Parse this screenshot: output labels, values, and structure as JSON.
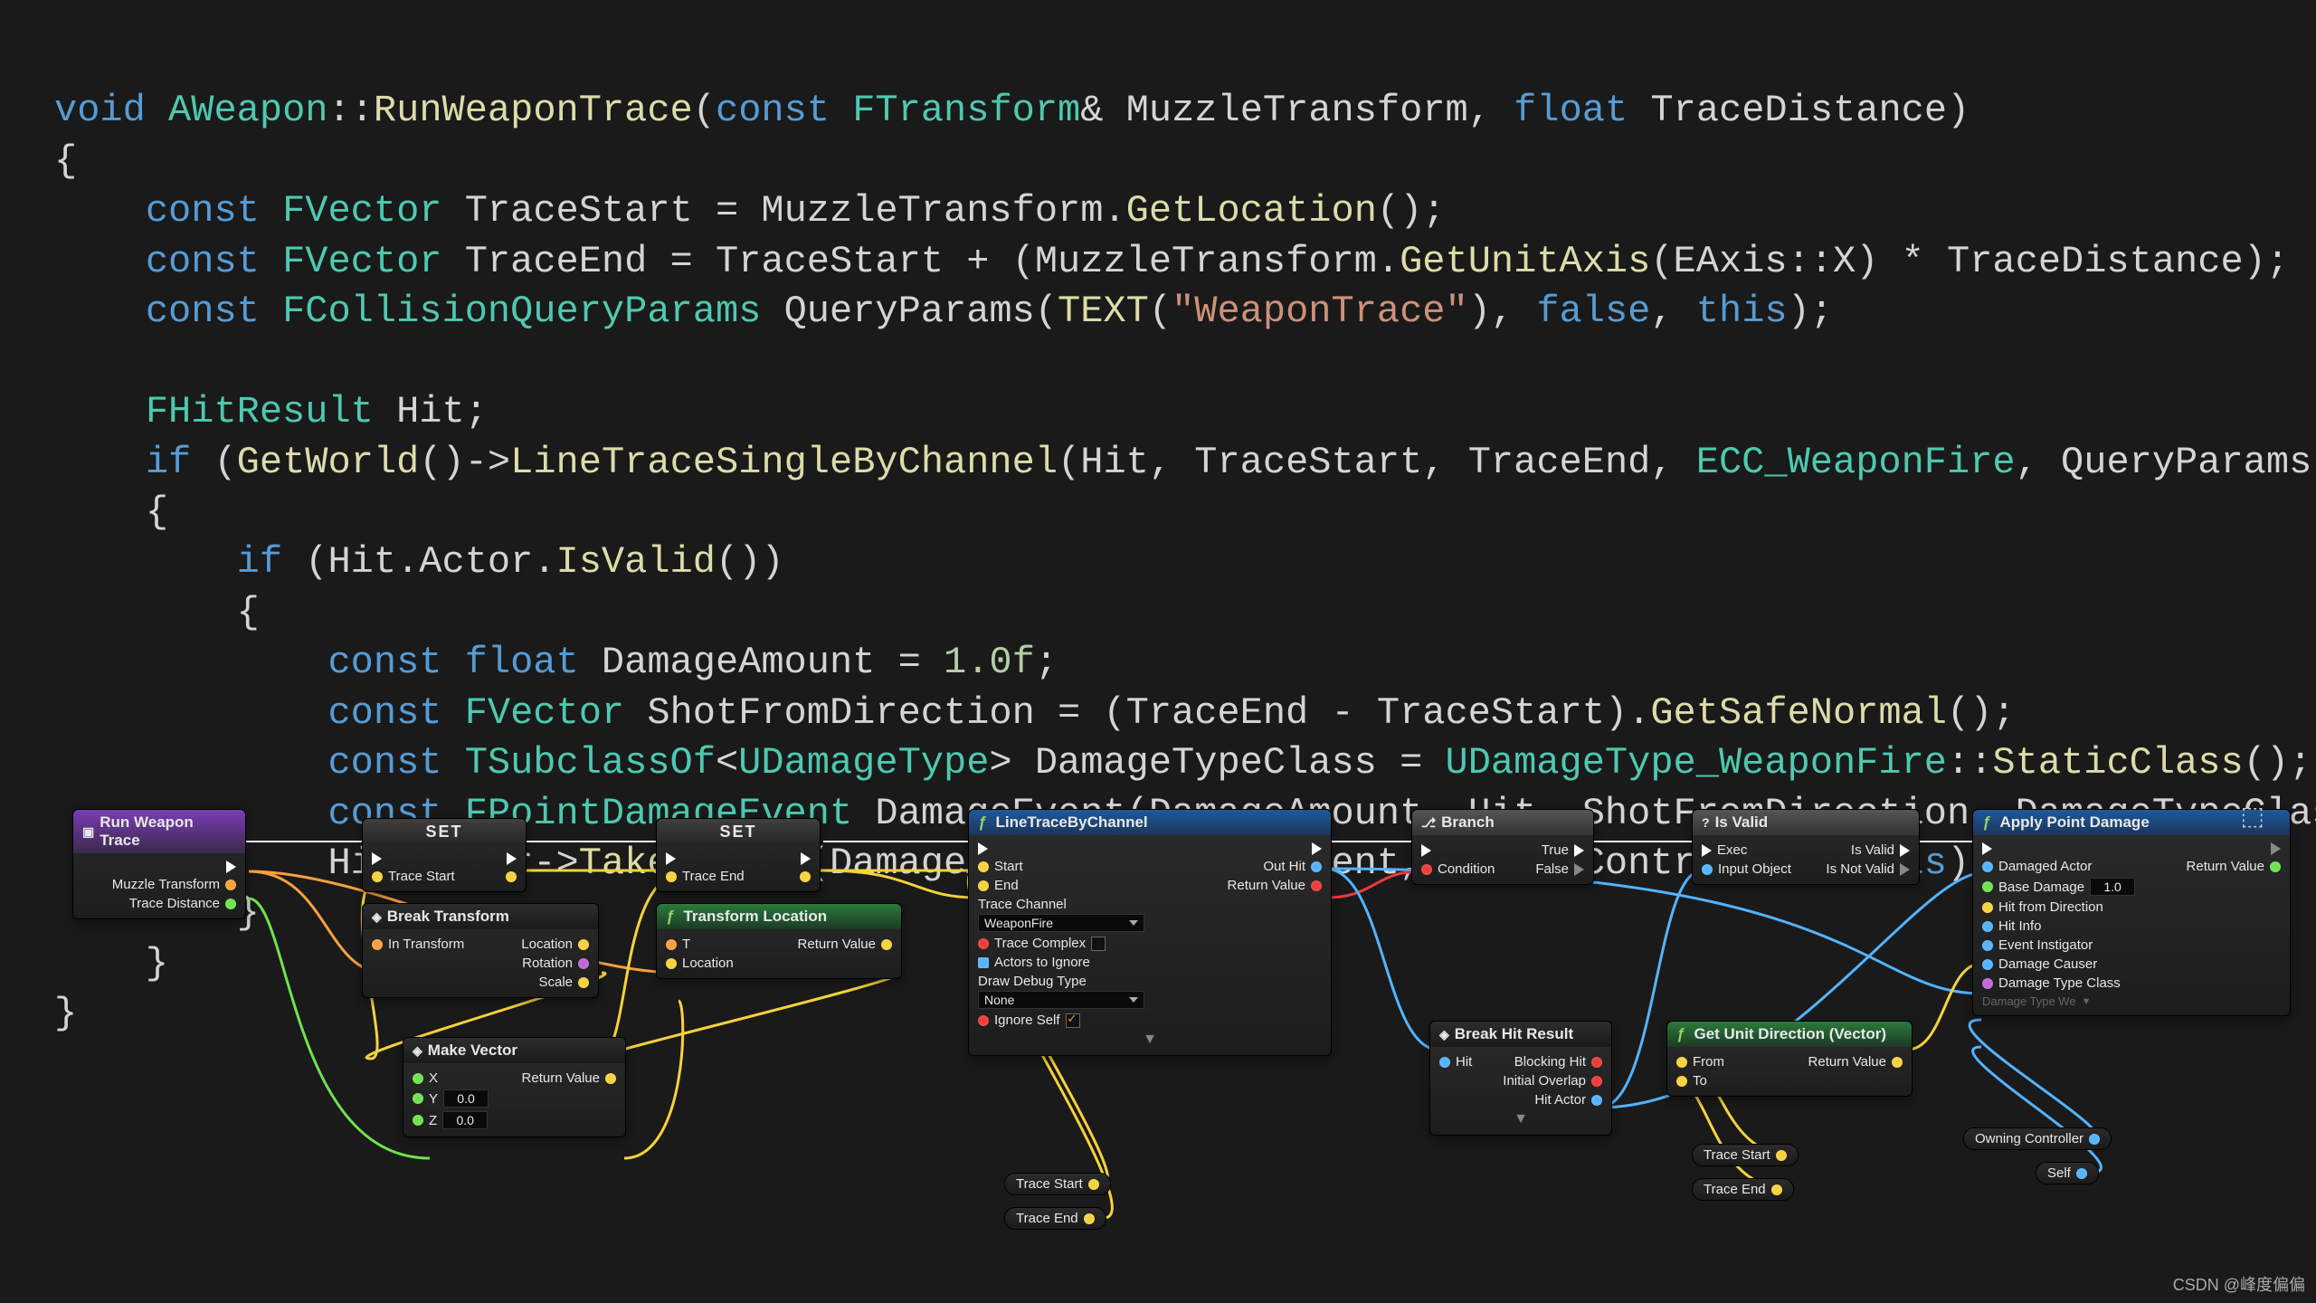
{
  "code": {
    "t1_void": "void",
    "t1_class": "AWeapon",
    "t1_sep": "::",
    "t1_func": "RunWeaponTrace",
    "t1_rest1": "(",
    "t1_const1": "const",
    "t1_type1": " FTransform",
    "t1_amp": "&",
    "t1_p1": " MuzzleTransform",
    "t1_comma": ", ",
    "t1_float": "float",
    "t1_p2": " TraceDistance)",
    "brace_open": "{",
    "brace_close": "}",
    "l3_const": "const",
    "l3_type": " FVector",
    "l3_id": " TraceStart ",
    "l3_eq": "=",
    "l3_rest_a": " MuzzleTransform.",
    "l3_func": "GetLocation",
    "l3_rest_b": "();",
    "l4_const": "const",
    "l4_type": " FVector",
    "l4_id": " TraceEnd ",
    "l4_eq": "=",
    "l4_a": " TraceStart + (MuzzleTransform.",
    "l4_func": "GetUnitAxis",
    "l4_b": "(EAxis::X) * TraceDistance);",
    "l5_const": "const",
    "l5_type": " FCollisionQueryParams",
    "l5_a": " QueryParams(",
    "l5_text": "TEXT",
    "l5_b": "(",
    "l5_str": "\"WeaponTrace\"",
    "l5_c": "), ",
    "l5_false": "false",
    "l5_d": ", ",
    "l5_this": "this",
    "l5_e": ");",
    "l7_type": "FHitResult",
    "l7_id": " Hit;",
    "l8_if": "if",
    "l8_a": " (",
    "l8_getworld": "GetWorld",
    "l8_arrow": "()->",
    "l8_func": "LineTraceSingleByChannel",
    "l8_b": "(Hit, TraceStart, TraceEnd, ",
    "l8_ecc": "ECC_WeaponFire",
    "l8_c": ", QueryParams))",
    "l10_if": "if",
    "l10_a": " (Hit.Actor.",
    "l10_isvalid": "IsValid",
    "l10_b": "())",
    "l12_const": "const",
    "l12_float": " float",
    "l12_a": " DamageAmount = ",
    "l12_num": "1.0f",
    "l12_b": ";",
    "l13_const": "const",
    "l13_type": " FVector",
    "l13_a": " ShotFromDirection = (TraceEnd - TraceStart).",
    "l13_func": "GetSafeNormal",
    "l13_b": "();",
    "l14_const": "const",
    "l14_type": " TSubclassOf",
    "l14_a": "<",
    "l14_type2": "UDamageType",
    "l14_b": "> DamageTypeClass = ",
    "l14_type3": "UDamageType_WeaponFire",
    "l14_c": "::",
    "l14_func": "StaticClass",
    "l14_d": "();",
    "l15_const": "const",
    "l15_type": " FPointDamageEvent",
    "l15_a": " DamageEvent(DamageAmount, Hit, ShotFromDirection, DamageTypeClass);",
    "l16_a": "Hit.Actor->",
    "l16_func": "TakeDamage",
    "l16_b": "(DamageAmount, DamageEvent, OwningController, ",
    "l16_this": "this",
    "l16_c": ");"
  },
  "bp": {
    "n_run": {
      "title": "Run Weapon Trace",
      "muzzle": "Muzzle Transform",
      "dist": "Trace Distance"
    },
    "n_set1": {
      "title": "SET",
      "var": "Trace Start"
    },
    "n_set2": {
      "title": "SET",
      "var": "Trace End"
    },
    "n_break": {
      "title": "Break Transform",
      "in": "In Transform",
      "loc": "Location",
      "rot": "Rotation",
      "scale": "Scale"
    },
    "n_trloc": {
      "title": "Transform Location",
      "t": "T",
      "loc": "Location",
      "ret": "Return Value"
    },
    "n_mkvec": {
      "title": "Make Vector",
      "x": "X",
      "y": "Y",
      "z": "Z",
      "yv": "0.0",
      "zv": "0.0",
      "ret": "Return Value"
    },
    "n_linetrace": {
      "title": "LineTraceByChannel",
      "start": "Start",
      "end": "End",
      "tracech": "Trace Channel",
      "tracech_val": "WeaponFire",
      "complex": "Trace Complex",
      "actors": "Actors to Ignore",
      "draw": "Draw Debug Type",
      "draw_val": "None",
      "ignore": "Ignore Self",
      "outhit": "Out Hit",
      "retval": "Return Value",
      "ts": "Trace Start",
      "te": "Trace End"
    },
    "n_branch": {
      "title": "Branch",
      "cond": "Condition",
      "true": "True",
      "false": "False"
    },
    "n_isvalid": {
      "title": "Is Valid",
      "exec": "Exec",
      "input": "Input Object",
      "isvalid": "Is Valid",
      "notvalid": "Is Not Valid"
    },
    "n_breakhit": {
      "title": "Break Hit Result",
      "hit": "Hit",
      "block": "Blocking Hit",
      "overlap": "Initial Overlap",
      "actor": "Hit Actor"
    },
    "n_unitdir": {
      "title": "Get Unit Direction (Vector)",
      "from": "From",
      "to": "To",
      "ret": "Return Value",
      "ts": "Trace Start",
      "te": "Trace End"
    },
    "n_apply": {
      "title": "Apply Point Damage",
      "damaged": "Damaged Actor",
      "base": "Base Damage",
      "baseval": "1.0",
      "hitfrom": "Hit from Direction",
      "hitinfo": "Hit Info",
      "inst": "Event Instigator",
      "causer": "Damage Causer",
      "dtclass": "Damage Type Class",
      "dtghost": "Damage Type We",
      "owning": "Owning Controller",
      "self": "Self",
      "retval": "Return Value"
    }
  },
  "watermark": "CSDN @峰度偏偏"
}
